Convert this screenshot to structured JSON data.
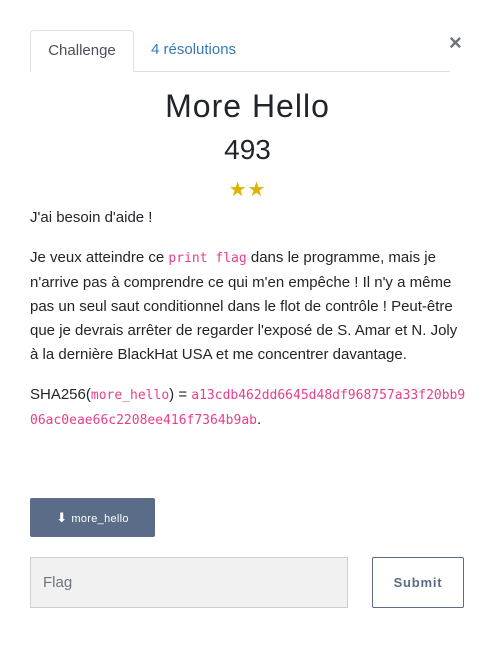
{
  "tabs": [
    {
      "label": "Challenge",
      "active": true
    },
    {
      "label": "4 résolutions",
      "active": false
    }
  ],
  "close_icon": "×",
  "challenge": {
    "name": "More Hello",
    "points": "493",
    "difficulty_stars": 2,
    "stars_text": "★★"
  },
  "description": {
    "p1": "J'ai besoin d'aide !",
    "p2_before": "Je veux atteindre ce ",
    "p2_code": "print flag",
    "p2_after": " dans le programme, mais je n'arrive pas à comprendre ce qui m'en empêche ! Il n'y a même pas un seul saut conditionnel dans le flot de contrôle ! Peut-être que je devrais arrêter de regarder l'exposé de S. Amar et N. Joly à la dernière BlackHat USA et me concentrer davantage.",
    "sha_prefix": "SHA256(",
    "sha_file": "more_hello",
    "sha_mid": ") =",
    "sha_value": "a13cdb462dd6645d48df968757a33f20bb906ac0eae66c2208ee416f7364b9ab",
    "sha_end": "."
  },
  "download": {
    "label": "more_hello",
    "icon": "download-icon"
  },
  "flag_input": {
    "placeholder": "Flag"
  },
  "submit": {
    "label": "Submit"
  },
  "colors": {
    "accent": "#5a6c87",
    "link": "#337ab7",
    "code": "#e83e8c",
    "star": "#e0b200"
  }
}
